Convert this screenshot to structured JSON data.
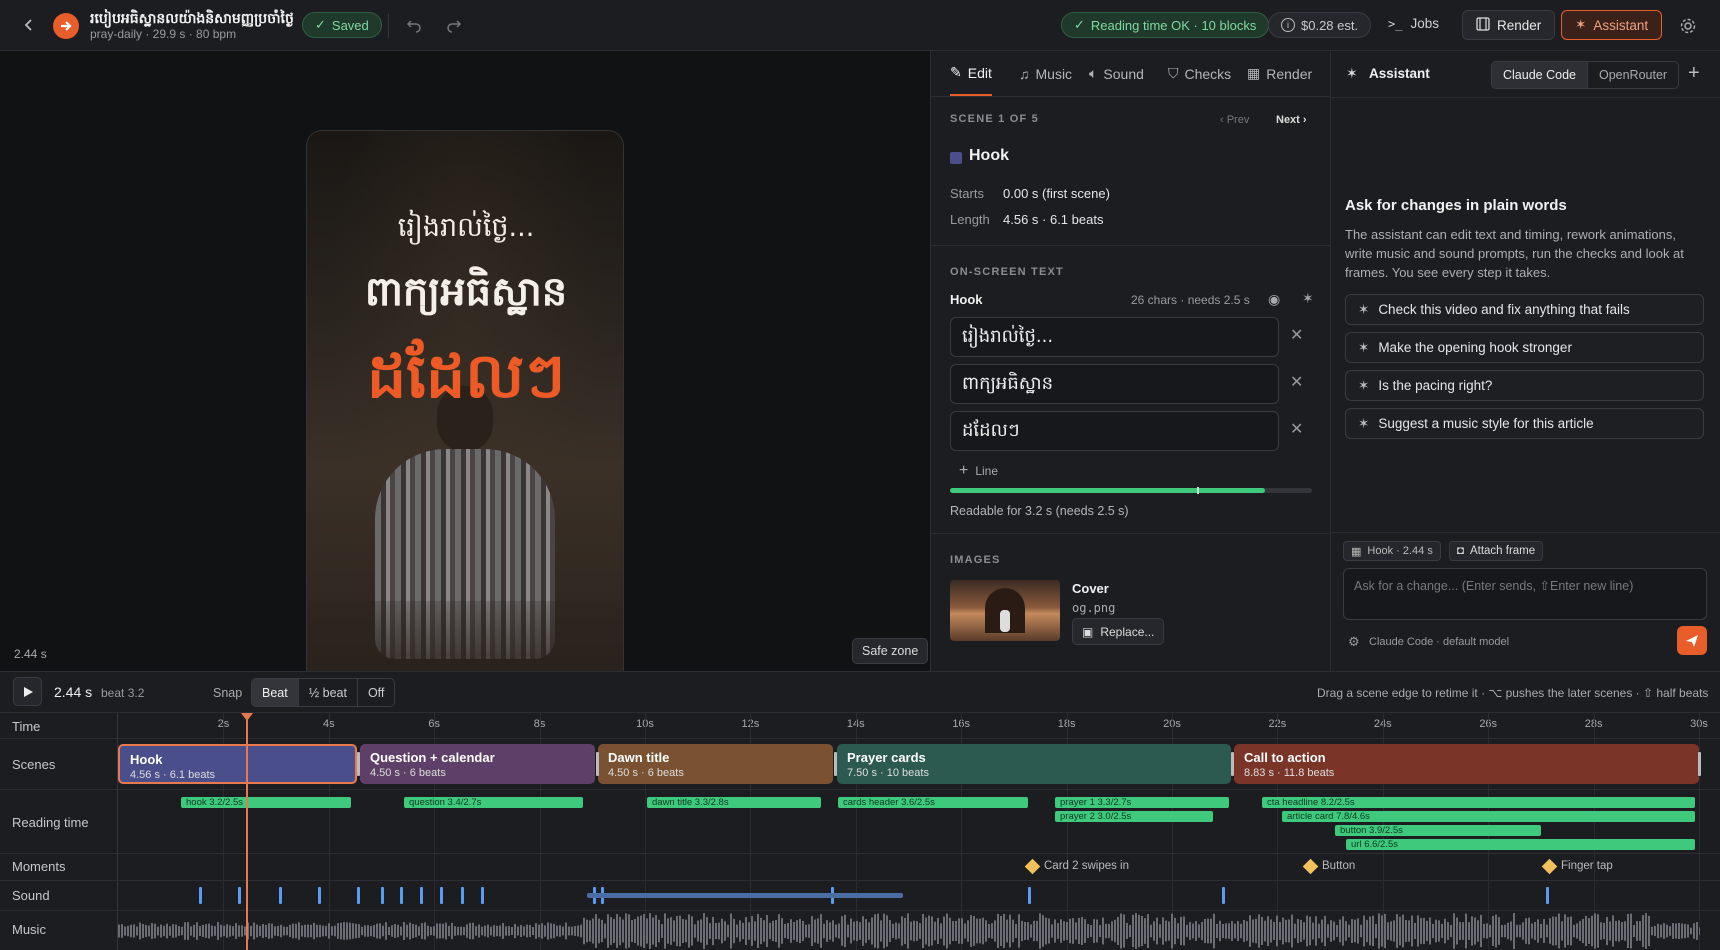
{
  "header": {
    "title": "របៀបអធិស្ឋានលយ៉ាងនិសាមញ្ញប្រចាំថ្ងៃ",
    "subtitle": "pray-daily · 29.9 s · 80 bpm",
    "saved": "Saved",
    "reading_ok": "Reading time OK · 10 blocks",
    "cost": "$0.28 est.",
    "jobs": "Jobs",
    "render": "Render",
    "assistant": "Assistant"
  },
  "preview": {
    "line1": "រៀងរាល់ថ្ងៃ...",
    "line2": "ពាក្យអធិស្ឋាន",
    "line3": "ដដែលៗ",
    "time": "2.44 s",
    "safe_zone": "Safe zone"
  },
  "edit": {
    "tabs": [
      "Edit",
      "Music",
      "Sound",
      "Checks",
      "Render"
    ],
    "scene_label": "SCENE 1 OF 5",
    "prev": "‹ Prev",
    "next": "Next ›",
    "scene_name": "Hook",
    "scene_color": "#4a4f8c",
    "starts_label": "Starts",
    "starts_value": "0.00 s (first scene)",
    "length_label": "Length",
    "length_value": "4.56 s · 6.1 beats",
    "onscreen_label": "ON-SCREEN TEXT",
    "block_name": "Hook",
    "block_meta": "26 chars · needs 2.5 s",
    "lines": [
      "រៀងរាល់ថ្ងៃ...",
      "ពាក្យអធិស្ឋាន",
      "ដដែលៗ"
    ],
    "add_line": "Line",
    "readable": "Readable for 3.2 s (needs 2.5 s)",
    "readable_fraction": 0.87,
    "images_label": "IMAGES",
    "image_title": "Cover",
    "image_file": "og.png",
    "replace": "Replace..."
  },
  "assistant": {
    "title": "Assistant",
    "mode_a": "Claude Code",
    "mode_b": "OpenRouter",
    "heading": "Ask for changes in plain words",
    "body": "The assistant can edit text and timing, rework animations, write music and sound prompts, run the checks and look at frames. You see every step it takes.",
    "suggestions": [
      "Check this video and fix anything that fails",
      "Make the opening hook stronger",
      "Is the pacing right?",
      "Suggest a music style for this article"
    ],
    "chip_scene": "Hook · 2.44 s",
    "attach": "Attach frame",
    "placeholder": "Ask for a change...  (Enter sends, ⇧Enter new line)",
    "model": "Claude Code · default model"
  },
  "transport": {
    "time": "2.44 s",
    "beat": "beat 3.2",
    "snap": "Snap",
    "snap_options": [
      "Beat",
      "½ beat",
      "Off"
    ],
    "hint": "Drag a scene edge to retime it · ⌥ pushes the later scenes · ⇧ half beats"
  },
  "timeline": {
    "rows": [
      "Time",
      "Scenes",
      "Reading time",
      "Moments",
      "Sound",
      "Music"
    ],
    "ticks": [
      "2s",
      "4s",
      "6s",
      "8s",
      "10s",
      "12s",
      "14s",
      "16s",
      "18s",
      "20s",
      "22s",
      "24s",
      "26s",
      "28s",
      "30s"
    ],
    "scenes": [
      {
        "title": "Hook",
        "sub": "4.56 s · 6.1 beats",
        "color": "#4a4f8c"
      },
      {
        "title": "Question + calendar",
        "sub": "4.50 s · 6 beats",
        "color": "#5e3f68"
      },
      {
        "title": "Dawn title",
        "sub": "4.50 s · 6 beats",
        "color": "#7a5232"
      },
      {
        "title": "Prayer cards",
        "sub": "7.50 s · 10 beats",
        "color": "#2d5a50"
      },
      {
        "title": "Call to action",
        "sub": "8.83 s · 11.8 beats",
        "color": "#7a3428"
      }
    ],
    "reading": [
      "hook 3.2/2.5s",
      "question 3.4/2.7s",
      "dawn title 3.3/2.8s",
      "cards header 3.6/2.5s",
      "prayer 1 3.3/2.7s",
      "prayer 2 3.0/2.5s",
      "cta headline 8.2/2.5s",
      "article card 7.8/4.6s",
      "button 3.9/2.5s",
      "url 6.6/2.5s"
    ],
    "moments": [
      "Card 2 swipes in",
      "Button",
      "Finger tap"
    ]
  }
}
